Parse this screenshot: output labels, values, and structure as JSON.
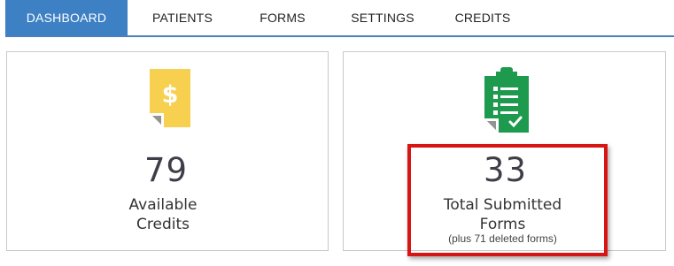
{
  "nav": {
    "tabs": [
      {
        "label": "DASHBOARD",
        "active": true
      },
      {
        "label": "PATIENTS",
        "active": false
      },
      {
        "label": "FORMS",
        "active": false
      },
      {
        "label": "SETTINGS",
        "active": false
      },
      {
        "label": "CREDITS",
        "active": false
      }
    ]
  },
  "cards": {
    "credits": {
      "icon": "dollar-document-icon",
      "value": "79",
      "label_line1": "Available",
      "label_line2": "Credits"
    },
    "forms": {
      "icon": "clipboard-checklist-icon",
      "value": "33",
      "label_line1": "Total Submitted",
      "label_line2": "Forms",
      "note": "(plus 71 deleted forms)"
    }
  },
  "colors": {
    "nav_active": "#3d80c4",
    "nav_underline": "#4a7fc0",
    "credits_icon": "#f7d04f",
    "forms_icon": "#1e9a4e",
    "highlight": "#d81515"
  }
}
